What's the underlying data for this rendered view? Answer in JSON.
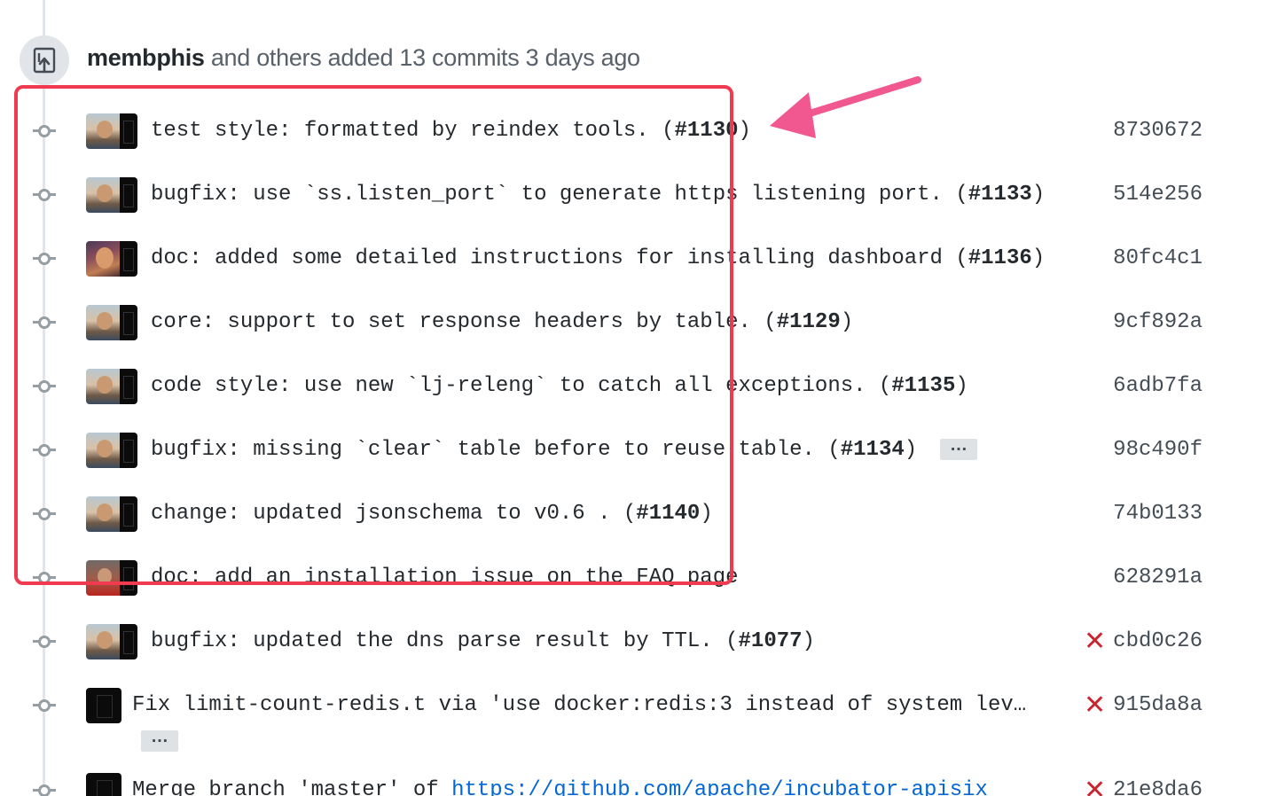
{
  "header": {
    "author": "membphis",
    "summary": " and others added 13 commits 3 days ago"
  },
  "commits": [
    {
      "prefix": "test style: formatted by reindex tools. (",
      "issue": "#1130",
      "suffix": ")",
      "sha": "8730672"
    },
    {
      "prefix": "bugfix: use `ss.listen_port` to generate https listening port. (",
      "issue": "#1133",
      "suffix": ")",
      "sha": "514e256"
    },
    {
      "prefix": "doc: added some detailed instructions for installing dashboard (",
      "issue": "#1136",
      "suffix": ")",
      "sha": "80fc4c1"
    },
    {
      "prefix": "core: support to set response headers by table. (",
      "issue": "#1129",
      "suffix": ")",
      "sha": "9cf892a"
    },
    {
      "prefix": "code style: use new `lj-releng` to catch all exceptions. (",
      "issue": "#1135",
      "suffix": ")",
      "sha": "6adb7fa"
    },
    {
      "prefix": "bugfix: missing `clear` table before to reuse table. (",
      "issue": "#1134",
      "suffix": ")",
      "sha": "98c490f",
      "more": "…"
    },
    {
      "prefix": "change: updated jsonschema to v0.6 . (",
      "issue": "#1140",
      "suffix": ")",
      "sha": "74b0133"
    },
    {
      "prefix": "doc: add an installation issue on the FAQ page",
      "sha": "628291a"
    },
    {
      "prefix": "bugfix: updated the dns parse result by TTL. (",
      "issue": "#1077",
      "suffix": ")",
      "sha": "cbd0c26",
      "status": "✕"
    },
    {
      "prefix": "Fix limit-count-redis.t via 'use docker:redis:3 instead of system lev…",
      "sha": "915da8a",
      "status": "✕",
      "more": "…"
    },
    {
      "prefix": "Merge branch 'master' of ",
      "link": "https://github.com/apache/incubator-apisix",
      "sha": "21e8da6",
      "status": "✕"
    }
  ],
  "colors": {
    "highlight": "#ef3a4f",
    "arrow": "#f0588f",
    "fail": "#cb2431"
  },
  "icons": {
    "header": "repo-push-icon",
    "node": "git-commit-icon",
    "status": "x-icon"
  }
}
